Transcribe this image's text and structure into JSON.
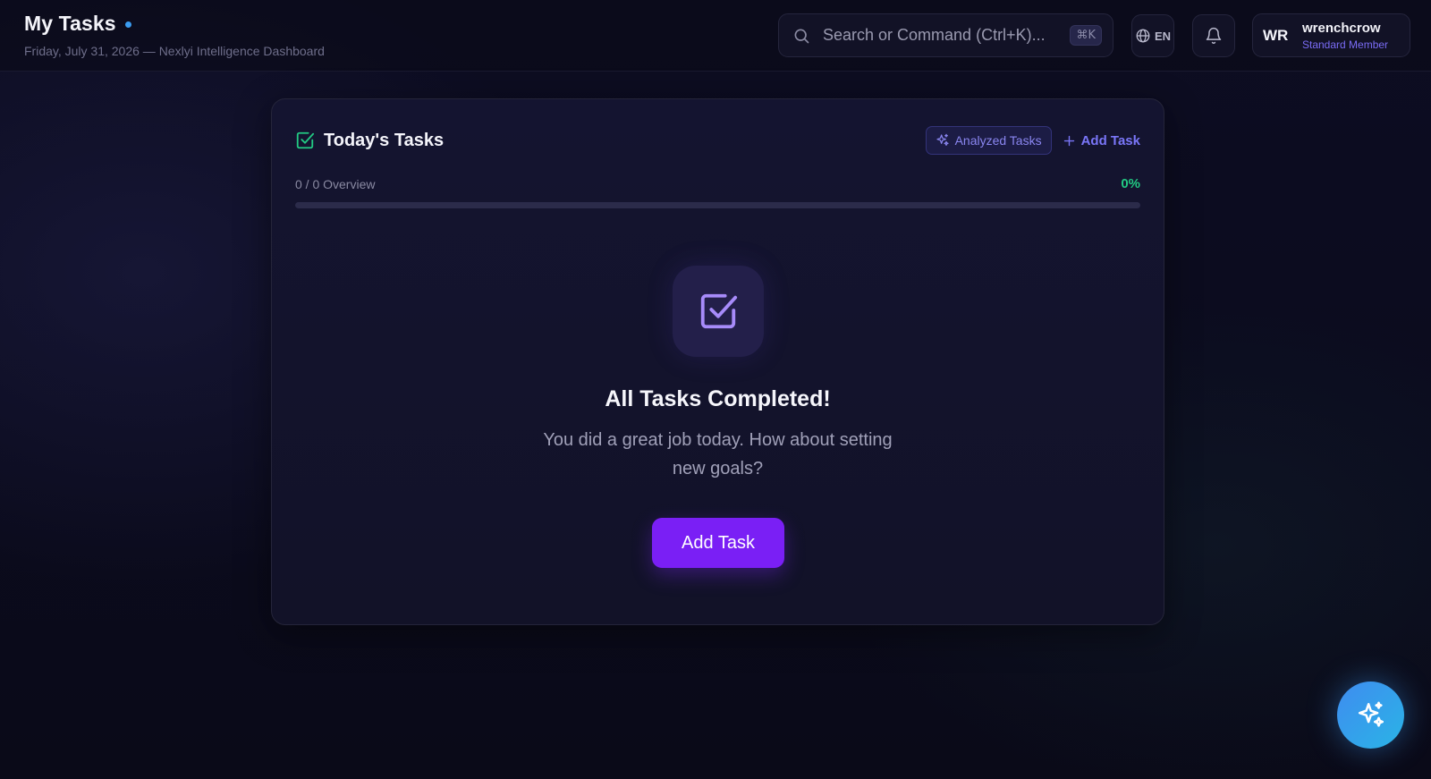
{
  "header": {
    "title": "My Tasks",
    "subtitle": "Friday, July 31, 2026 — Nexlyi Intelligence Dashboard",
    "search_placeholder": "Search or Command (Ctrl+K)...",
    "search_shortcut": "⌘K",
    "language": "EN",
    "user": {
      "initials": "WR",
      "name": "wrenchcrow",
      "role": "Standard Member"
    }
  },
  "card": {
    "title": "Today's Tasks",
    "analyzed_label": "Analyzed Tasks",
    "add_label": "Add Task",
    "progress_text": "0 / 0 Overview",
    "progress_percent": "0%",
    "progress_value": 0,
    "empty_title": "All Tasks Completed!",
    "empty_message": "You did a great job today. How about setting new goals?",
    "cta_label": "Add Task"
  },
  "colors": {
    "accent": "#7a1ff5",
    "link": "#7a76f8",
    "success": "#22c983",
    "fab": "#3f8cf0"
  },
  "icons": {
    "search": "search-icon",
    "language": "globe-icon",
    "notifications": "bell-icon",
    "card": "check-square-icon",
    "analyzed": "sparkles-icon",
    "add": "plus-icon",
    "empty": "check-square-icon",
    "fab": "sparkles-icon"
  }
}
